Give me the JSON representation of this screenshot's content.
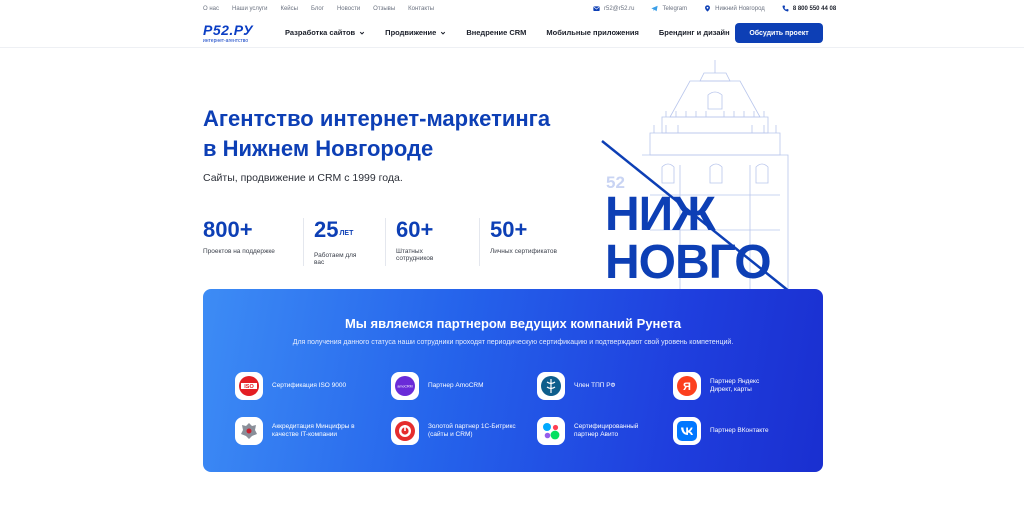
{
  "topbar": {
    "links": [
      "О нас",
      "Наши услуги",
      "Кейсы",
      "Блог",
      "Новости",
      "Отзывы",
      "Контакты"
    ],
    "email": "r52@r52.ru",
    "telegram": "Telegram",
    "city": "Нижний Новгород",
    "phone": "8 800 550 44 08"
  },
  "header": {
    "logo_mark": "Р52.РУ",
    "logo_sub": "интернет-агентство",
    "menu": [
      "Разработка сайтов",
      "Продвижение",
      "Внедрение CRM",
      "Мобильные приложения",
      "Брендинг и дизайн"
    ],
    "cta": "Обсудить проект"
  },
  "hero": {
    "title_line1": "Агентство интернет-маркетинга",
    "title_line2": "в Нижнем Новгороде",
    "subtitle": "Сайты, продвижение и CRM с 1999 года.",
    "stats": [
      {
        "num": "800+",
        "suffix": "",
        "label": "Проектов на поддержке"
      },
      {
        "num": "25",
        "suffix": "ЛЕТ",
        "label": "Работаем для вас"
      },
      {
        "num": "60+",
        "suffix": "",
        "label": "Штатных сотрудников"
      },
      {
        "num": "50+",
        "suffix": "",
        "label": "Личных сертификатов"
      }
    ],
    "graphic_number": "52",
    "graphic_word1": "НИЖ",
    "graphic_word2": "НОВГО"
  },
  "partners": {
    "title": "Мы являемся партнером ведущих компаний Рунета",
    "subtitle": "Для получения данного статуса наши сотрудники проходят периодическую сертификацию и подтверждают свой уровень компетенций.",
    "items": [
      {
        "label": "Сертификация ISO 9000",
        "icon": "iso-icon"
      },
      {
        "label": "Партнер AmoCRM",
        "icon": "amocrm-icon"
      },
      {
        "label": "Член ТПП РФ",
        "icon": "tpp-icon"
      },
      {
        "label": "Партнер Яндекс Директ, карты",
        "icon": "yandex-icon"
      },
      {
        "label": "Аккредитация Минцифры в качестве IT-компании",
        "icon": "mintsifry-icon"
      },
      {
        "label": "Золотой партнер 1С-Битрикс (сайты и CRM)",
        "icon": "bitrix-icon"
      },
      {
        "label": "Сертифицированный партнер Авито",
        "icon": "avito-icon"
      },
      {
        "label": "Партнер ВКонтакте",
        "icon": "vk-icon"
      }
    ]
  },
  "colors": {
    "brand": "#0d3fb5",
    "card_start": "#3d8cf5",
    "card_end": "#1a2fd0"
  }
}
